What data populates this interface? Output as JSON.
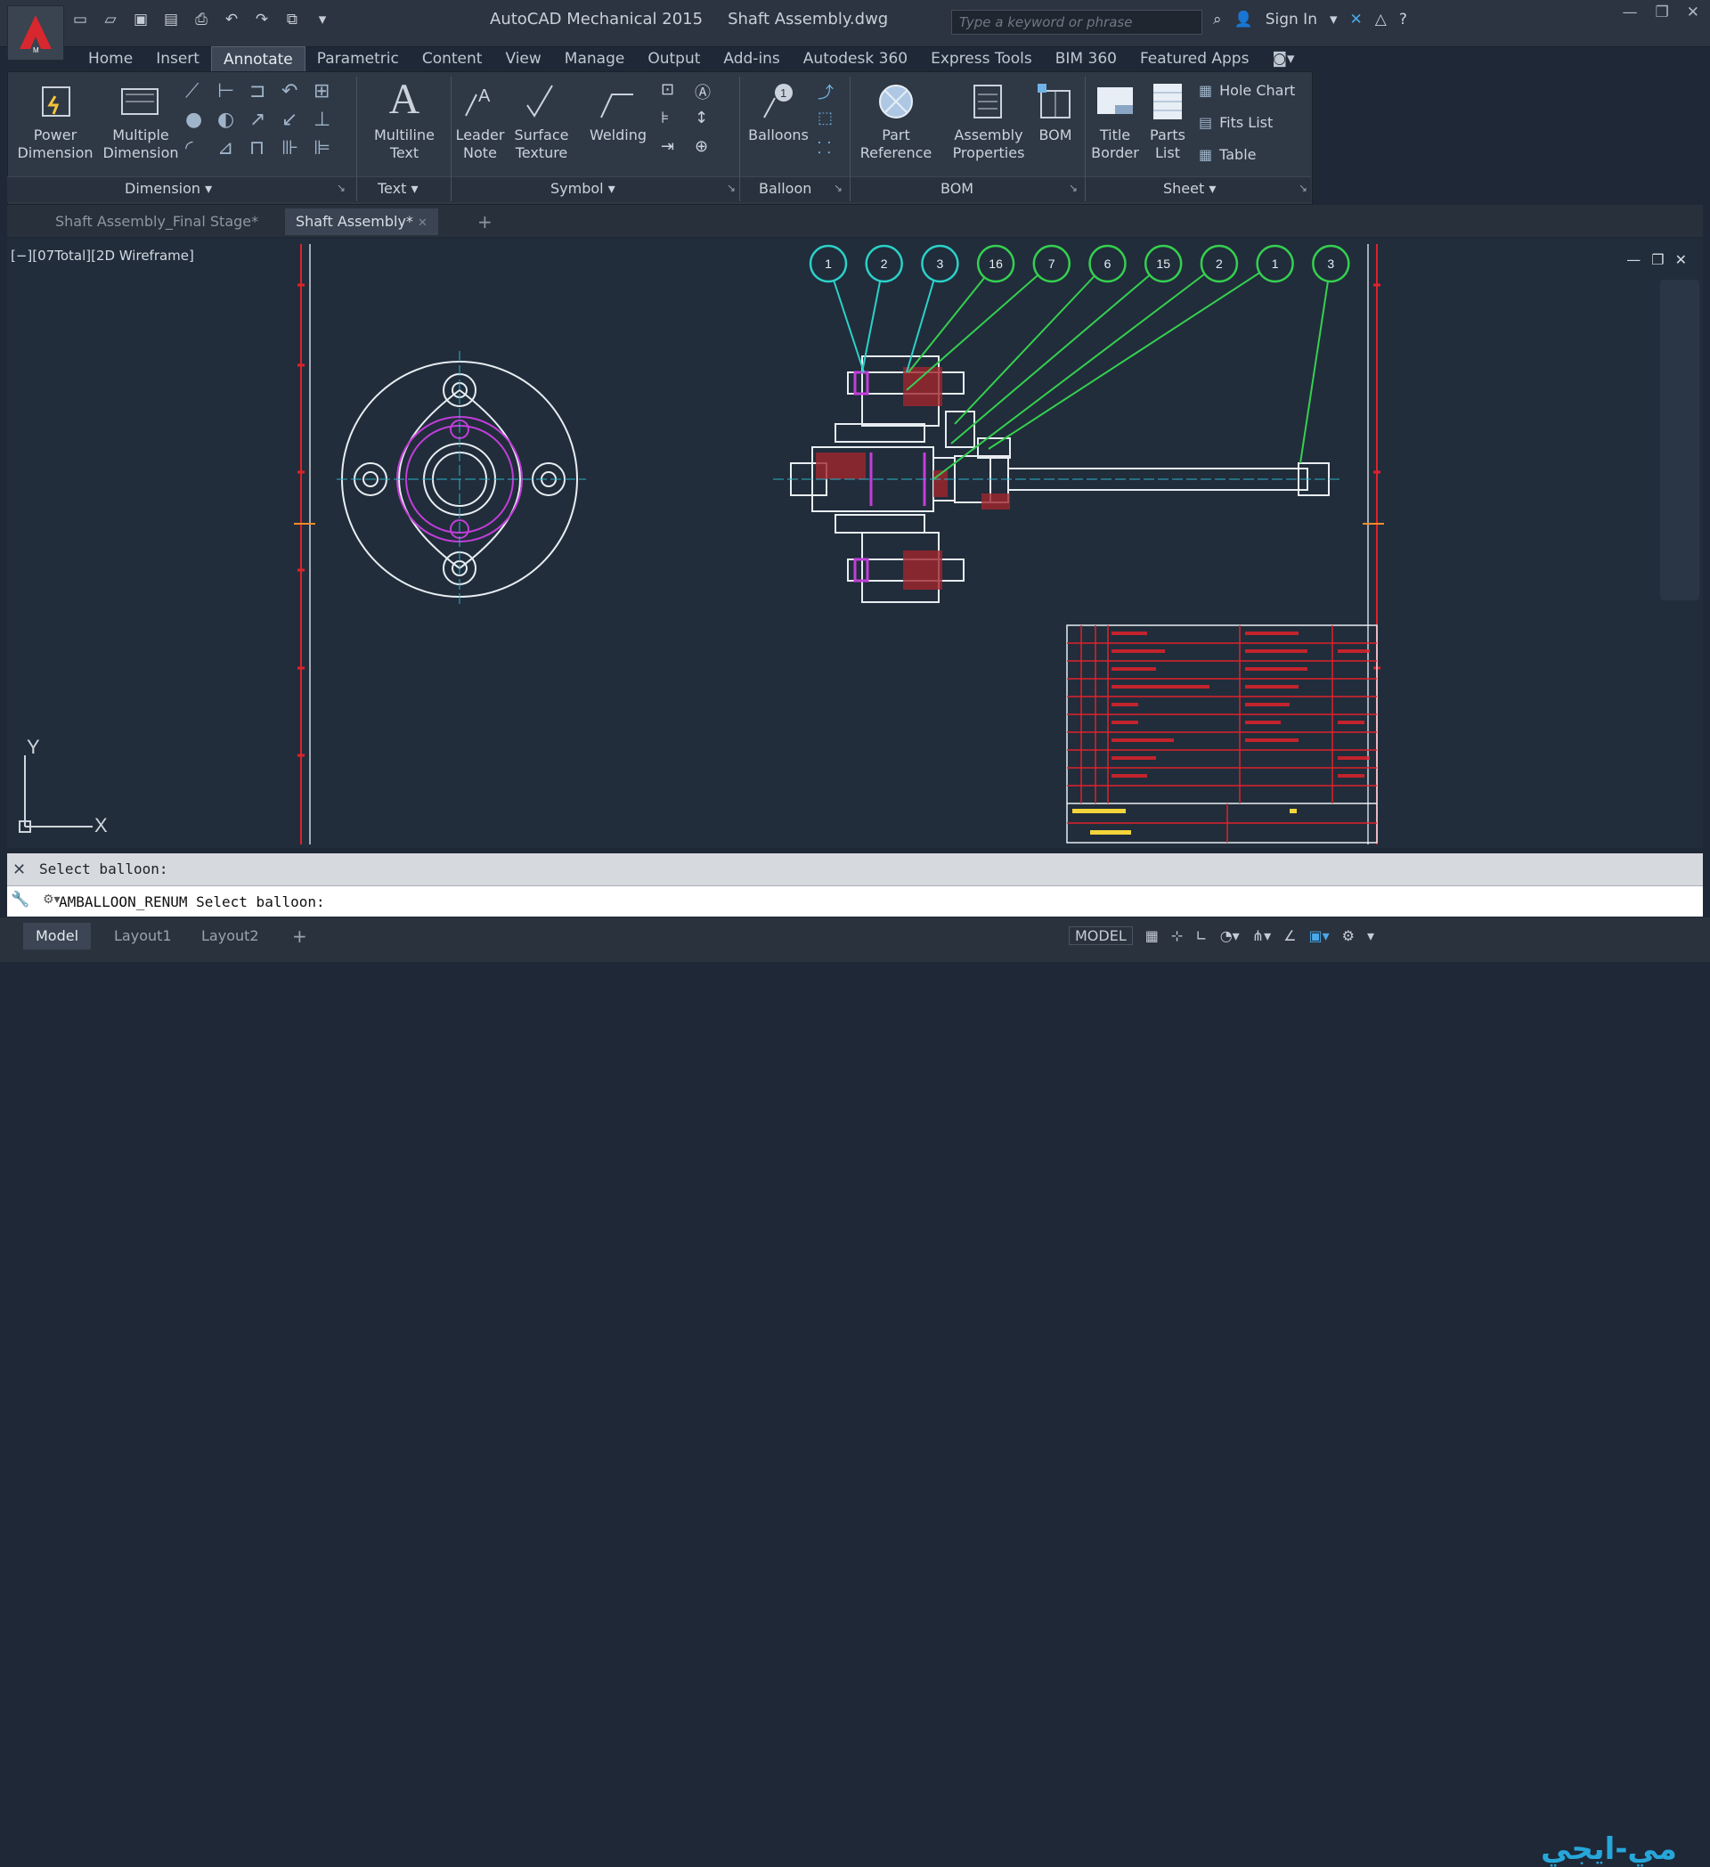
{
  "app": {
    "name": "AutoCAD Mechanical 2015",
    "file": "Shaft Assembly.dwg",
    "search_placeholder": "Type a keyword or phrase",
    "sign_in": "Sign In"
  },
  "ribbon_tabs": [
    "Home",
    "Insert",
    "Annotate",
    "Parametric",
    "Content",
    "View",
    "Manage",
    "Output",
    "Add-ins",
    "Autodesk 360",
    "Express Tools",
    "BIM 360",
    "Featured Apps"
  ],
  "active_tab": "Annotate",
  "ribbon": {
    "dimension": {
      "power": "Power\nDimension",
      "multiple": "Multiple\nDimension",
      "group": "Dimension"
    },
    "text": {
      "multiline": "Multiline\nText",
      "group": "Text"
    },
    "symbol": {
      "leader": "Leader\nNote",
      "surface": "Surface\nTexture",
      "welding": "Welding",
      "group": "Symbol"
    },
    "balloon": {
      "balloons": "Balloons",
      "group": "Balloon"
    },
    "bom": {
      "part_ref": "Part\nReference",
      "assembly": "Assembly\nProperties",
      "bom": "BOM",
      "group": "BOM"
    },
    "sheet": {
      "title_border": "Title\nBorder",
      "parts_list": "Parts\nList",
      "hole_chart": "Hole Chart",
      "fits_list": "Fits List",
      "table": "Table",
      "group": "Sheet"
    }
  },
  "doc_tabs": [
    "Shaft Assembly_Final Stage*",
    "Shaft Assembly*"
  ],
  "viewport_label": "[−][07Total][2D Wireframe]",
  "balloons": [
    "1",
    "2",
    "3",
    "16",
    "7",
    "6",
    "15",
    "2",
    "1",
    "3"
  ],
  "ucs": {
    "x": "X",
    "y": "Y"
  },
  "command": {
    "history": "Select balloon:",
    "prompt": "AMBALLOON_RENUM Select balloon:"
  },
  "layout_tabs": [
    "Model",
    "Layout1",
    "Layout2"
  ],
  "status": {
    "model": "MODEL"
  },
  "watermark": "مي-ايجي",
  "colors": {
    "background": "#212d3b",
    "accent_cyan": "#2bd1c7",
    "accent_green": "#35d04f",
    "frame_red": "#e0222a"
  }
}
